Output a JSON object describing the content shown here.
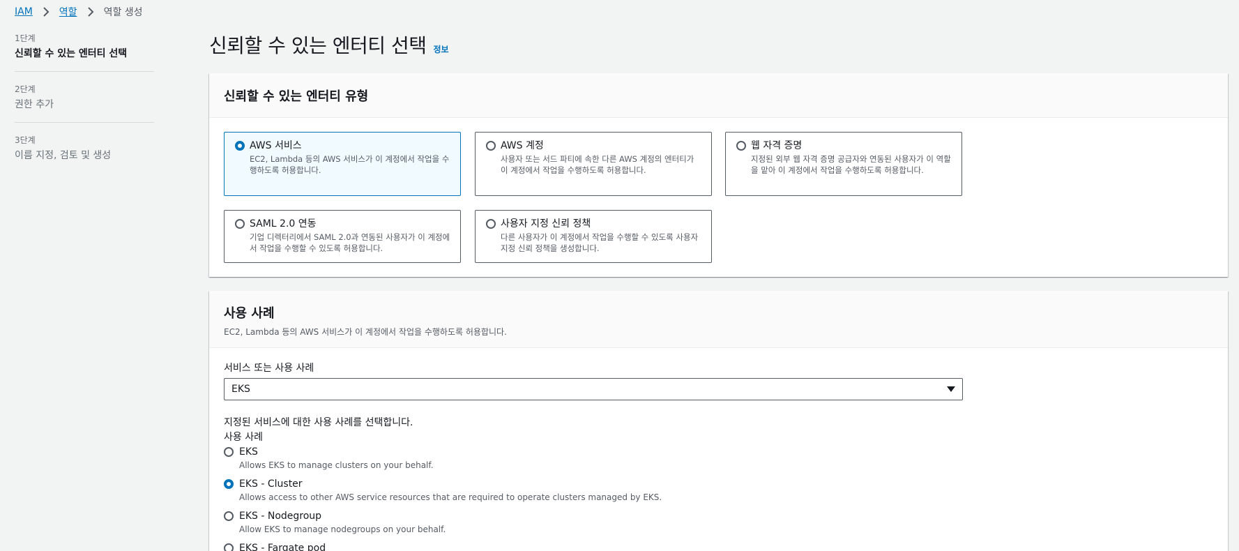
{
  "breadcrumb": {
    "items": [
      "IAM",
      "역할",
      "역할 생성"
    ]
  },
  "steps": [
    {
      "num": "1단계",
      "title": "신뢰할 수 있는 엔터티 선택"
    },
    {
      "num": "2단계",
      "title": "권한 추가"
    },
    {
      "num": "3단계",
      "title": "이름 지정, 검토 및 생성"
    }
  ],
  "page": {
    "title": "신뢰할 수 있는 엔터티 선택",
    "info": "정보"
  },
  "entity_panel": {
    "heading": "신뢰할 수 있는 엔터티 유형",
    "options": [
      {
        "name": "AWS 서비스",
        "desc": "EC2, Lambda 등의 AWS 서비스가 이 계정에서 작업을 수행하도록 허용합니다.",
        "selected": true
      },
      {
        "name": "AWS 계정",
        "desc": "사용자 또는 서드 파티에 속한 다른 AWS 계정의 엔터티가 이 계정에서 작업을 수행하도록 허용합니다.",
        "selected": false
      },
      {
        "name": "웹 자격 증명",
        "desc": "지정된 외부 웹 자격 증명 공급자와 연동된 사용자가 이 역할을 맡아 이 계정에서 작업을 수행하도록 허용합니다.",
        "selected": false
      },
      {
        "name": "SAML 2.0 연동",
        "desc": "기업 디렉터리에서 SAML 2.0과 연동된 사용자가 이 계정에서 작업을 수행할 수 있도록 허용합니다.",
        "selected": false
      },
      {
        "name": "사용자 지정 신뢰 정책",
        "desc": "다른 사용자가 이 계정에서 작업을 수행할 수 있도록 사용자 지정 신뢰 정책을 생성합니다.",
        "selected": false
      }
    ]
  },
  "use_case_panel": {
    "heading": "사용 사례",
    "desc": "EC2, Lambda 등의 AWS 서비스가 이 계정에서 작업을 수행하도록 허용합니다.",
    "service_label": "서비스 또는 사용 사례",
    "service_value": "EKS",
    "select_hint": "지정된 서비스에 대한 사용 사례를 선택합니다.",
    "use_case_label": "사용 사례",
    "options": [
      {
        "name": "EKS",
        "desc": "Allows EKS to manage clusters on your behalf.",
        "selected": false
      },
      {
        "name": "EKS - Cluster",
        "desc": "Allows access to other AWS service resources that are required to operate clusters managed by EKS.",
        "selected": true
      },
      {
        "name": "EKS - Nodegroup",
        "desc": "Allow EKS to manage nodegroups on your behalf.",
        "selected": false
      },
      {
        "name": "EKS - Fargate pod",
        "desc": "",
        "selected": false
      }
    ]
  },
  "colors": {
    "link": "#0073bb",
    "selected_bg": "#f1faff",
    "page_bg": "#f2f3f3"
  }
}
